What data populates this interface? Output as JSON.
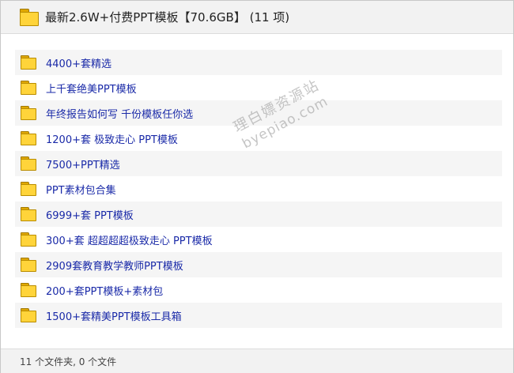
{
  "header": {
    "title": "最新2.6W+付费PPT模板【70.6GB】 (11 项)",
    "icon": "folder-icon"
  },
  "items": [
    {
      "label": "4400+套精选"
    },
    {
      "label": "上千套绝美PPT模板"
    },
    {
      "label": "年终报告如何写 千份模板任你选"
    },
    {
      "label": "1200+套 极致走心 PPT模板"
    },
    {
      "label": "7500+PPT精选"
    },
    {
      "label": "PPT素材包合集"
    },
    {
      "label": "6999+套 PPT模板"
    },
    {
      "label": "300+套 超超超超极致走心 PPT模板"
    },
    {
      "label": "2909套教育教学教师PPT模板"
    },
    {
      "label": "200+套PPT模板+素材包"
    },
    {
      "label": "1500+套精美PPT模板工具箱"
    }
  ],
  "footer": {
    "status": "11 个文件夹, 0 个文件"
  },
  "watermark": {
    "line1": "理白嫖资源站",
    "line2": "byepiao.com"
  },
  "colors": {
    "link": "#1a2aa8",
    "folder": "#ffd43a",
    "header_bg": "#f2f2f2"
  }
}
